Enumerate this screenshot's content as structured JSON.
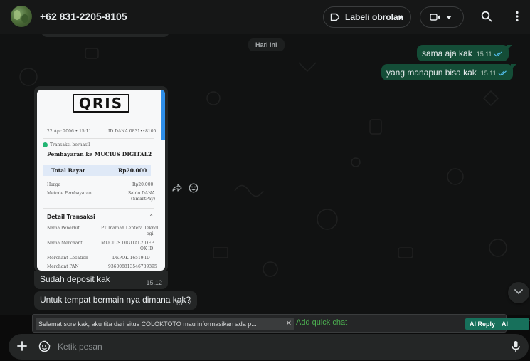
{
  "header": {
    "contact_name": "+62 831-2205-8105",
    "label_button": "Labeli obrolan"
  },
  "chat": {
    "date_divider": "Hari Ini",
    "outgoing": [
      {
        "text": "sama aja kak",
        "time": "15.11",
        "status": "read"
      },
      {
        "text": "yang manapun bisa kak",
        "time": "15.11",
        "status": "read"
      }
    ],
    "image_message": {
      "receipt": {
        "logo": "QRIS",
        "date": "22 Apr 2006 • 15:11",
        "dana_id": "ID DANA 0831••8105",
        "status": "Transaksi berhasil",
        "merchant_line": "Pembayaran ke MUCIUS DIGITAL2",
        "total_label": "Total Bayar",
        "total_value": "Rp20.000",
        "price_label": "Harga",
        "price_value": "Rp20.000",
        "method_label": "Metode Pembayaran",
        "method_value_1": "Saldo DANA",
        "method_value_2": "(SmartPay)",
        "detail_title": "Detail Transaksi",
        "issuer_label": "Nama Penerbit",
        "issuer_value_1": "PT Inamah Lentera Teknol",
        "issuer_value_2": "ogi",
        "merchant_label": "Nama Merchant",
        "merchant_value_1": "MUCIUS DIGITAL2 DEP",
        "merchant_value_2": "OK ID",
        "location_label": "Merchant Location",
        "location_value": "DEPOK 16519 ID",
        "pan_label": "Merchant PAN",
        "pan_value": "936008813546789395"
      }
    },
    "incoming": [
      {
        "text": "Sudah deposit kak",
        "time": "15.12"
      },
      {
        "text": "Untuk tempat bermain nya dimana kak?",
        "time": "15.12"
      }
    ]
  },
  "quick_chat": {
    "chip": "Selamat sore kak, aku tita dari situs COLOKTOTO mau informasikan ada p...",
    "add_label": "Add quick chat",
    "ai_reply": "AI Reply",
    "ai_rewrite": "AI Rewrite"
  },
  "composer": {
    "placeholder": "Ketik pesan"
  },
  "colors": {
    "outgoing_bubble": "#144d37",
    "incoming_bubble": "#242626",
    "ai_button": "#17705b",
    "read_ticks": "#53bdeb"
  },
  "icons": [
    "avatar",
    "label-icon",
    "video-icon",
    "search-icon",
    "menu-icon",
    "forward-icon",
    "emoji-icon",
    "chevron-down-icon",
    "plus-icon",
    "sticker-icon",
    "mic-icon"
  ]
}
